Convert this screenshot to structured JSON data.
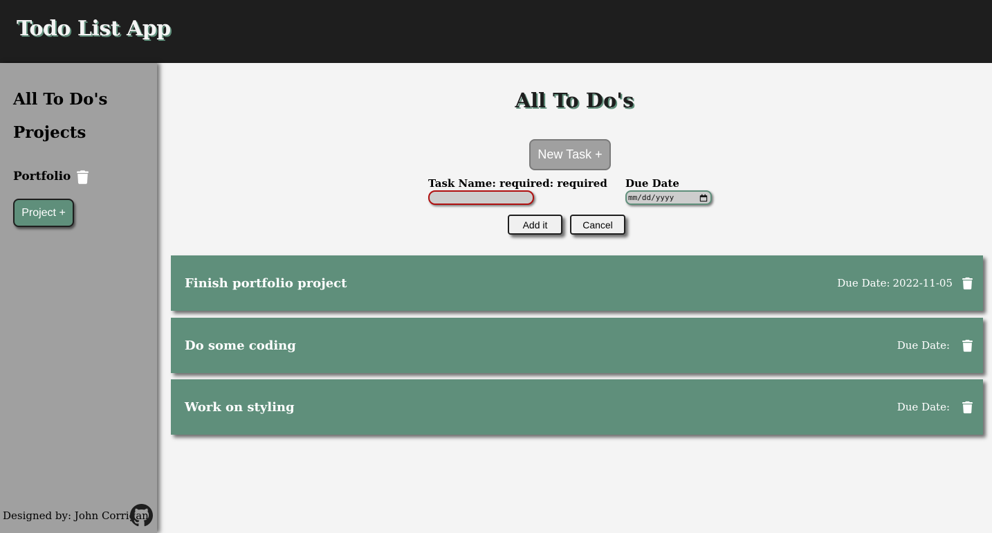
{
  "header": {
    "title": "Todo List App"
  },
  "sidebar": {
    "all_todos": "All To Do's",
    "projects_heading": "Projects",
    "projects": [
      {
        "name": "Portfolio"
      }
    ],
    "add_project_label": "Project +",
    "footer_text": "Designed by: John Corrigan",
    "footer_icon": "github-icon"
  },
  "main": {
    "title": "All To Do's",
    "new_task_label": "New Task +",
    "form": {
      "task_name_label": "Task Name: required: required",
      "task_name_value": "",
      "due_date_label": "Due Date",
      "due_date_placeholder": "mm/dd/yyyy",
      "add_label": "Add it",
      "cancel_label": "Cancel"
    },
    "tasks": [
      {
        "name": "Finish portfolio project",
        "due_label": "Due Date:",
        "due_value": "2022-11-05"
      },
      {
        "name": "Do some coding",
        "due_label": "Due Date:",
        "due_value": ""
      },
      {
        "name": "Work on styling",
        "due_label": "Due Date:",
        "due_value": ""
      }
    ]
  },
  "colors": {
    "header_bg": "#1e1e1e",
    "sidebar_bg": "#a0a0a0",
    "accent_green": "#5f8f7b",
    "main_bg": "#f4f4f4",
    "invalid_border": "#b01010"
  },
  "icons": {
    "delete": "trash-icon",
    "date_picker": "calendar-icon"
  }
}
